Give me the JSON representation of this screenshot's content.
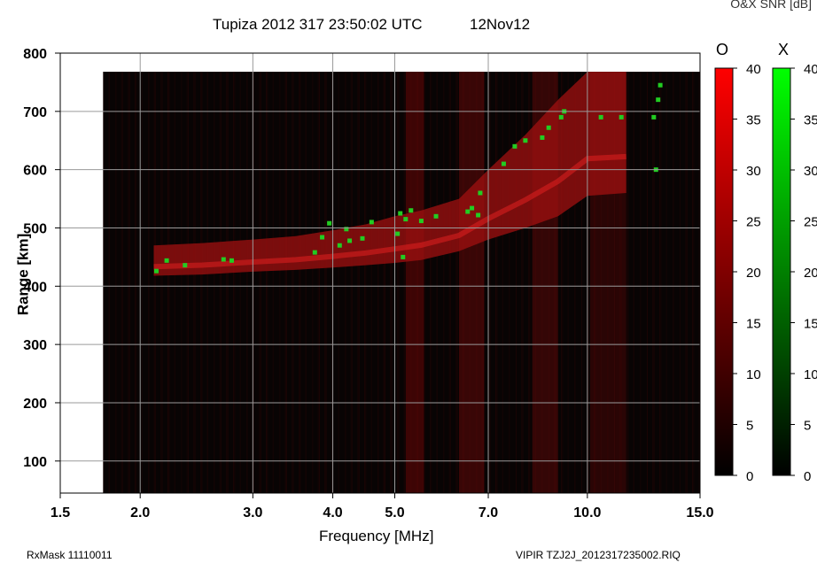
{
  "header": {
    "title": "Tupiza 2012 317 23:50:02 UTC",
    "date": "12Nov12",
    "snr_caption": "O&X SNR [dB]"
  },
  "footer": {
    "rxmask": "RxMask 11110011",
    "filename": "VIPIR  TZJ2J_2012317235002.RIQ"
  },
  "colorbars": {
    "o": {
      "label": "O",
      "ticks": [
        "40",
        "35",
        "30",
        "25",
        "20",
        "15",
        "10",
        "5",
        "0"
      ],
      "color": "#ff0000"
    },
    "x": {
      "label": "X",
      "ticks": [
        "40",
        "35",
        "30",
        "25",
        "20",
        "15",
        "10",
        "5",
        "0"
      ],
      "color": "#00ff00"
    }
  },
  "chart_data": {
    "type": "heatmap",
    "title": "Tupiza 2012 317 23:50:02 UTC",
    "xlabel": "Frequency [MHz]",
    "ylabel": "Range [km]",
    "x_scale": "log",
    "xlim": [
      1.5,
      15.0
    ],
    "ylim": [
      45,
      800
    ],
    "x_ticks": [
      {
        "value": 1.5,
        "label": "1.5"
      },
      {
        "value": 2.0,
        "label": "2.0"
      },
      {
        "value": 3.0,
        "label": "3.0"
      },
      {
        "value": 4.0,
        "label": "4.0"
      },
      {
        "value": 5.0,
        "label": "5.0"
      },
      {
        "value": 7.0,
        "label": "7.0"
      },
      {
        "value": 10.0,
        "label": "10.0"
      },
      {
        "value": 15.0,
        "label": "15.0"
      }
    ],
    "y_ticks": [
      {
        "value": 100,
        "label": "100"
      },
      {
        "value": 200,
        "label": "200"
      },
      {
        "value": 300,
        "label": "300"
      },
      {
        "value": 400,
        "label": "400"
      },
      {
        "value": 500,
        "label": "500"
      },
      {
        "value": 600,
        "label": "600"
      },
      {
        "value": 700,
        "label": "700"
      },
      {
        "value": 800,
        "label": "800"
      }
    ],
    "grid": true,
    "data_extent": {
      "fmin": 1.75,
      "rmax": 768
    },
    "o_trace": [
      {
        "f": 2.1,
        "r0": 418,
        "r1": 470
      },
      {
        "f": 2.5,
        "r0": 420,
        "r1": 474
      },
      {
        "f": 3.0,
        "r0": 425,
        "r1": 480
      },
      {
        "f": 3.5,
        "r0": 428,
        "r1": 486
      },
      {
        "f": 4.0,
        "r0": 432,
        "r1": 496
      },
      {
        "f": 4.5,
        "r0": 436,
        "r1": 506
      },
      {
        "f": 5.0,
        "r0": 440,
        "r1": 520
      },
      {
        "f": 5.5,
        "r0": 445,
        "r1": 530
      },
      {
        "f": 6.3,
        "r0": 460,
        "r1": 550
      },
      {
        "f": 7.0,
        "r0": 480,
        "r1": 600
      },
      {
        "f": 8.0,
        "r0": 500,
        "r1": 660
      },
      {
        "f": 9.0,
        "r0": 520,
        "r1": 720
      },
      {
        "f": 10.0,
        "r0": 555,
        "r1": 768
      },
      {
        "f": 11.5,
        "r0": 560,
        "r1": 768
      }
    ],
    "o_bands": [
      {
        "f0": 5.2,
        "f1": 5.55,
        "r0": 45,
        "r1": 768,
        "level": 0.55
      },
      {
        "f0": 6.3,
        "f1": 6.9,
        "r0": 45,
        "r1": 768,
        "level": 0.5
      },
      {
        "f0": 8.2,
        "f1": 9.0,
        "r0": 45,
        "r1": 768,
        "level": 0.45
      },
      {
        "f0": 10.1,
        "f1": 11.5,
        "r0": 45,
        "r1": 768,
        "level": 0.35
      }
    ],
    "x_echoes": [
      {
        "f": 2.12,
        "r": 426
      },
      {
        "f": 2.2,
        "r": 444
      },
      {
        "f": 2.35,
        "r": 436
      },
      {
        "f": 2.7,
        "r": 446
      },
      {
        "f": 2.78,
        "r": 444
      },
      {
        "f": 3.75,
        "r": 458
      },
      {
        "f": 3.85,
        "r": 484
      },
      {
        "f": 3.95,
        "r": 508
      },
      {
        "f": 4.1,
        "r": 470
      },
      {
        "f": 4.2,
        "r": 498
      },
      {
        "f": 4.25,
        "r": 478
      },
      {
        "f": 4.45,
        "r": 482
      },
      {
        "f": 4.6,
        "r": 510
      },
      {
        "f": 5.05,
        "r": 490
      },
      {
        "f": 5.1,
        "r": 525
      },
      {
        "f": 5.15,
        "r": 450
      },
      {
        "f": 5.2,
        "r": 515
      },
      {
        "f": 5.3,
        "r": 530
      },
      {
        "f": 5.5,
        "r": 512
      },
      {
        "f": 5.8,
        "r": 520
      },
      {
        "f": 6.5,
        "r": 528
      },
      {
        "f": 6.6,
        "r": 534
      },
      {
        "f": 6.75,
        "r": 522
      },
      {
        "f": 6.8,
        "r": 560
      },
      {
        "f": 7.4,
        "r": 610
      },
      {
        "f": 7.7,
        "r": 640
      },
      {
        "f": 8.0,
        "r": 650
      },
      {
        "f": 8.5,
        "r": 655
      },
      {
        "f": 8.7,
        "r": 672
      },
      {
        "f": 9.1,
        "r": 690
      },
      {
        "f": 9.2,
        "r": 700
      },
      {
        "f": 10.5,
        "r": 690
      },
      {
        "f": 11.3,
        "r": 690
      },
      {
        "f": 12.7,
        "r": 690
      },
      {
        "f": 12.9,
        "r": 720
      },
      {
        "f": 13.0,
        "r": 745
      },
      {
        "f": 12.8,
        "r": 600
      }
    ]
  }
}
